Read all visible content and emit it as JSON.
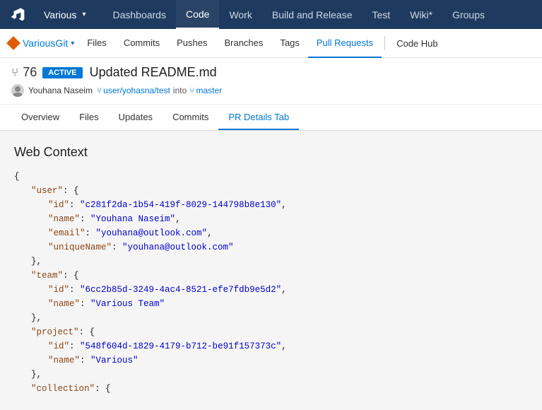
{
  "topNav": {
    "logo": "azure-devops-icon",
    "project": "Various",
    "items": [
      {
        "label": "Dashboards",
        "active": false
      },
      {
        "label": "Code",
        "active": true
      },
      {
        "label": "Work",
        "active": false
      },
      {
        "label": "Build and Release",
        "active": false
      },
      {
        "label": "Test",
        "active": false
      },
      {
        "label": "Wiki*",
        "active": false
      },
      {
        "label": "Groups",
        "active": false
      }
    ]
  },
  "subNav": {
    "repoName": "VariousGit",
    "items": [
      {
        "label": "Files",
        "active": false
      },
      {
        "label": "Commits",
        "active": false
      },
      {
        "label": "Pushes",
        "active": false
      },
      {
        "label": "Branches",
        "active": false
      },
      {
        "label": "Tags",
        "active": false
      },
      {
        "label": "Pull Requests",
        "active": true
      }
    ],
    "codeHub": "Code Hub"
  },
  "pr": {
    "icon": "⑂",
    "number": "76",
    "badge": "ACTIVE",
    "title": "Updated README.md",
    "author": "Youhana Naseim",
    "branchFrom": "user/yohasna/test",
    "into": "into",
    "branchTo": "master"
  },
  "prTabs": [
    {
      "label": "Overview",
      "active": false
    },
    {
      "label": "Files",
      "active": false
    },
    {
      "label": "Updates",
      "active": false
    },
    {
      "label": "Commits",
      "active": false
    },
    {
      "label": "PR Details Tab",
      "active": true
    }
  ],
  "content": {
    "title": "Web Context",
    "json": {
      "raw": [
        "{",
        "    \"user\": {",
        "        \"id\": \"c281f2da-1b54-419f-8029-144798b8e130\",",
        "        \"name\": \"Youhana Naseim\",",
        "        \"email\": \"youhana@outlook.com\",",
        "        \"uniqueName\": \"youhana@outlook.com\"",
        "    },",
        "    \"team\": {",
        "        \"id\": \"6cc2b85d-3249-4ac4-8521-efe7fdb9e5d2\",",
        "        \"name\": \"Various Team\"",
        "    },",
        "    \"project\": {",
        "        \"id\": \"548f604d-1829-4179-b712-be91f157373c\",",
        "        \"name\": \"Various\"",
        "    },",
        "    \"collection\": {"
      ]
    }
  },
  "colors": {
    "topNavBg": "#1e3a5f",
    "activeBorder": "#0078d4",
    "badgeBg": "#0078d4",
    "keyColor": "#8b4513",
    "stringColor": "#0000cd"
  }
}
